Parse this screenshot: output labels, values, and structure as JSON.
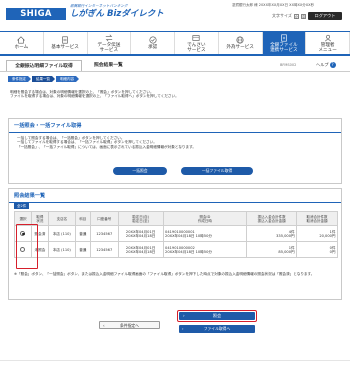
{
  "header": {
    "logo_text": "SHIGA BANK",
    "brand_small": "滋賀銀行インターネットバンキング",
    "brand_big": "しがぎん Bizダイレクト",
    "user_info": "滋賀銀行太郎 様  20XX年XX月XX日 XX時XX分XX秒",
    "font_size_label": "文字サイズ",
    "size_small": "小",
    "size_mid": "中",
    "size_big": "大",
    "logout_label": "ログアウト"
  },
  "nav": [
    {
      "label": "ホーム",
      "icon": "home-icon"
    },
    {
      "label": "基本サービス",
      "icon": "document-icon"
    },
    {
      "label": "データ伝送\nサービス",
      "icon": "transfer-icon"
    },
    {
      "label": "承認",
      "icon": "approval-icon"
    },
    {
      "label": "でんさい\nサービス",
      "icon": "densai-icon"
    },
    {
      "label": "外為サービス",
      "icon": "globe-icon"
    },
    {
      "label": "全銀ファイル\n連携サービス",
      "icon": "file-link-icon",
      "active": true
    },
    {
      "label": "管理者\nメニュー",
      "icon": "admin-icon"
    }
  ],
  "tabs": {
    "active": "全銀振込明細ファイル取得",
    "sub": "照会結果一覧",
    "screen_id": "BFMS002",
    "help": "ヘルプ"
  },
  "breadcrumbs": [
    "条件指定",
    "結果一覧",
    "明細内容"
  ],
  "intro_text": "明細を照会する場合は、対象の明細情報を選択の上、「照会」ボタンを押してください。\nファイルを取得する場合は、対象の明細情報を選択の上、「ファイル取得へ」ボタンを押してください。",
  "bulk": {
    "title": "一括照会・一括ファイル取得",
    "text": "一括して照会する場合は、「一括照会」ボタンを押してください。\n一括してファイルを取得する場合は、「一括ファイル取得」ボタンを押してください。\n「一括照会」、「一括ファイル取得」については、画面に表示されている振込入金明細情報が対象となります。",
    "inquiry_all_button": "一括照会",
    "fetch_all_button": "一括ファイル取得"
  },
  "results": {
    "title": "照会結果一覧",
    "badge": "全2件",
    "columns": [
      "選択",
      "取得\n状況",
      "支店名",
      "科目",
      "口座番号",
      "勘定日(自)\n勘定日(至)",
      "照会ID\n作成日時",
      "振込入金合計件数\n振込入金合計金額",
      "取消合計件数\n取消合計金額"
    ],
    "rows": [
      {
        "selected": true,
        "status": "照会済",
        "branch": "本店 (110)",
        "subject": "普通",
        "account": "1234567",
        "date_from": "20XX年04月01日",
        "date_to": "20XX年04月18日",
        "inquiry_id": "0419010000001",
        "created": "20XX年04月18日 10時50分",
        "total_count": "4件",
        "total_amount": "335,000円",
        "cancel_count": "1件",
        "cancel_amount": "20,000円"
      },
      {
        "selected": false,
        "status": "未照会",
        "branch": "本店 (110)",
        "subject": "普通",
        "account": "1234567",
        "date_from": "20XX年04月01日",
        "date_to": "20XX年04月18日",
        "inquiry_id": "0419010000002",
        "created": "20XX年04月18日 10時50分",
        "total_count": "1件",
        "total_amount": "85,000円",
        "cancel_count": "0件",
        "cancel_amount": "0円"
      }
    ],
    "note": "※「照会」ボタン、「一括照会」ボタン、または振込入金明細ファイル取得画面の「ファイル取得」ボタンを押下した時点で対象の振込入金明細情報の照会状況は「照会済」となります。"
  },
  "actions": {
    "back_button": "条件指定へ",
    "inquiry_button": "照会",
    "fetch_button": "ファイル取得へ"
  },
  "colors": {
    "brand_blue": "#1f64b8",
    "button_blue": "#1e5aa8",
    "highlight_red": "#d61f2b"
  }
}
